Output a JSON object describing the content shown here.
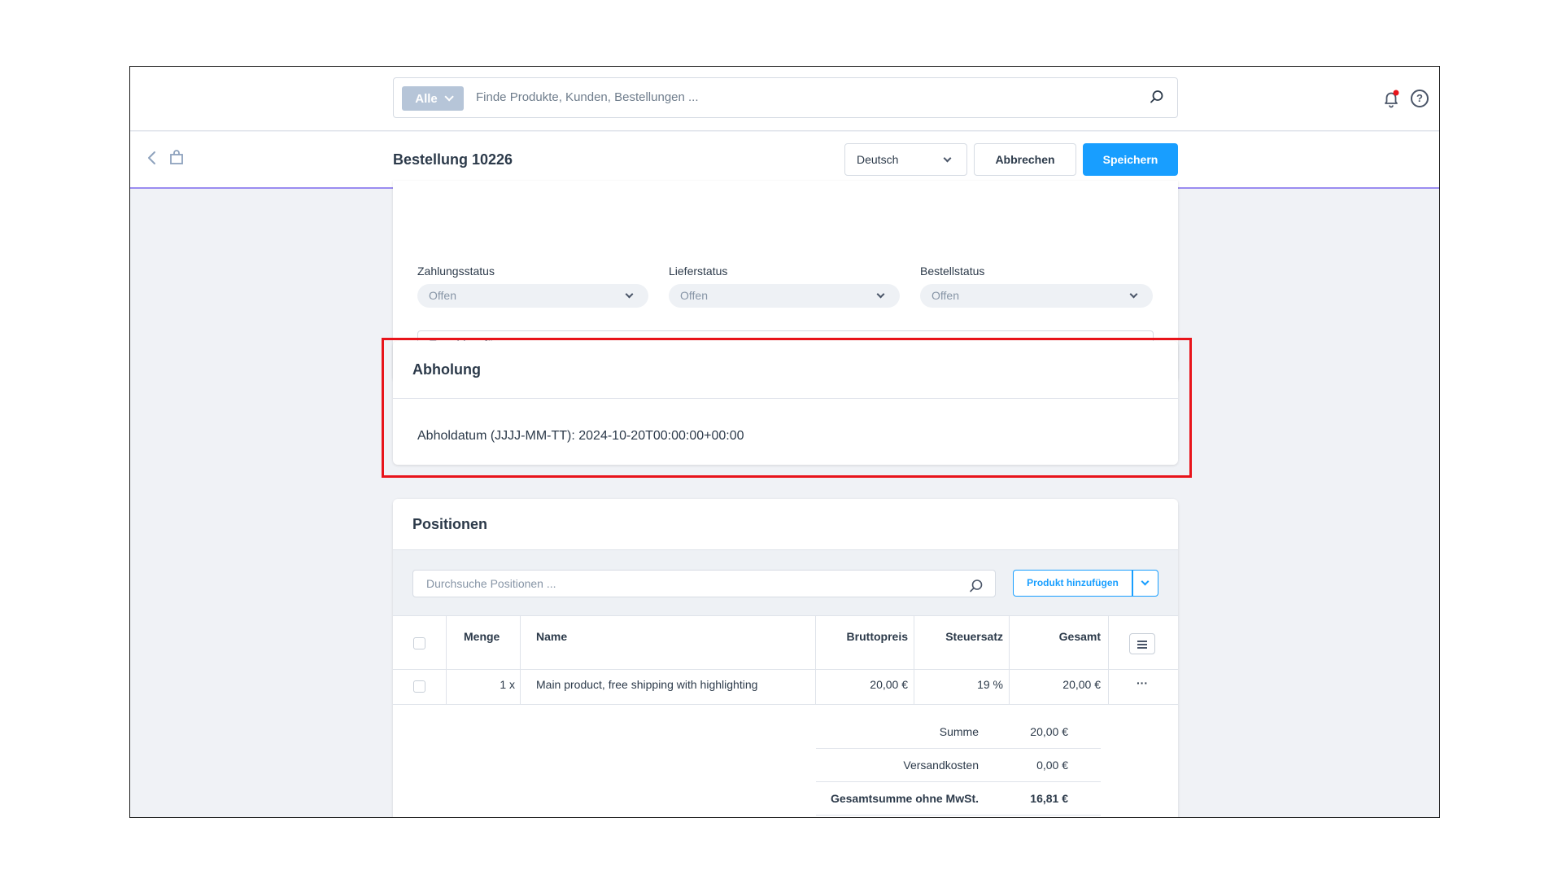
{
  "search": {
    "scope_label": "Alle",
    "placeholder": "Finde Produkte, Kunden, Bestellungen ..."
  },
  "header": {
    "title": "Bestellung 10226",
    "language": "Deutsch",
    "cancel_label": "Abbrechen",
    "save_label": "Speichern"
  },
  "status": {
    "payment_label": "Zahlungsstatus",
    "payment_value": "Offen",
    "delivery_label": "Lieferstatus",
    "delivery_value": "Offen",
    "order_label": "Bestellstatus",
    "order_value": "Offen",
    "tags_placeholder": "Tags hinzufügen ..."
  },
  "pickup": {
    "title": "Abholung",
    "date_text": "Abholdatum (JJJJ-MM-TT): 2024-10-20T00:00:00+00:00"
  },
  "positions": {
    "title": "Positionen",
    "search_placeholder": "Durchsuche Positionen ...",
    "add_label": "Produkt hinzufügen",
    "columns": {
      "quantity": "Menge",
      "name": "Name",
      "gross": "Bruttopreis",
      "tax": "Steuersatz",
      "total": "Gesamt"
    },
    "rows": [
      {
        "quantity": "1 x",
        "name": "Main product, free shipping with highlighting",
        "gross": "20,00 €",
        "tax": "19 %",
        "total": "20,00 €",
        "actions": "···"
      }
    ],
    "summary": {
      "sum_label": "Summe",
      "sum_value": "20,00 €",
      "shipping_label": "Versandkosten",
      "shipping_value": "0,00 €",
      "net_label": "Gesamtsumme ohne MwSt.",
      "net_value": "16,81 €"
    }
  },
  "colors": {
    "primary": "#189eff",
    "highlight": "#e8141b",
    "notification_dot": "#e8141b"
  }
}
